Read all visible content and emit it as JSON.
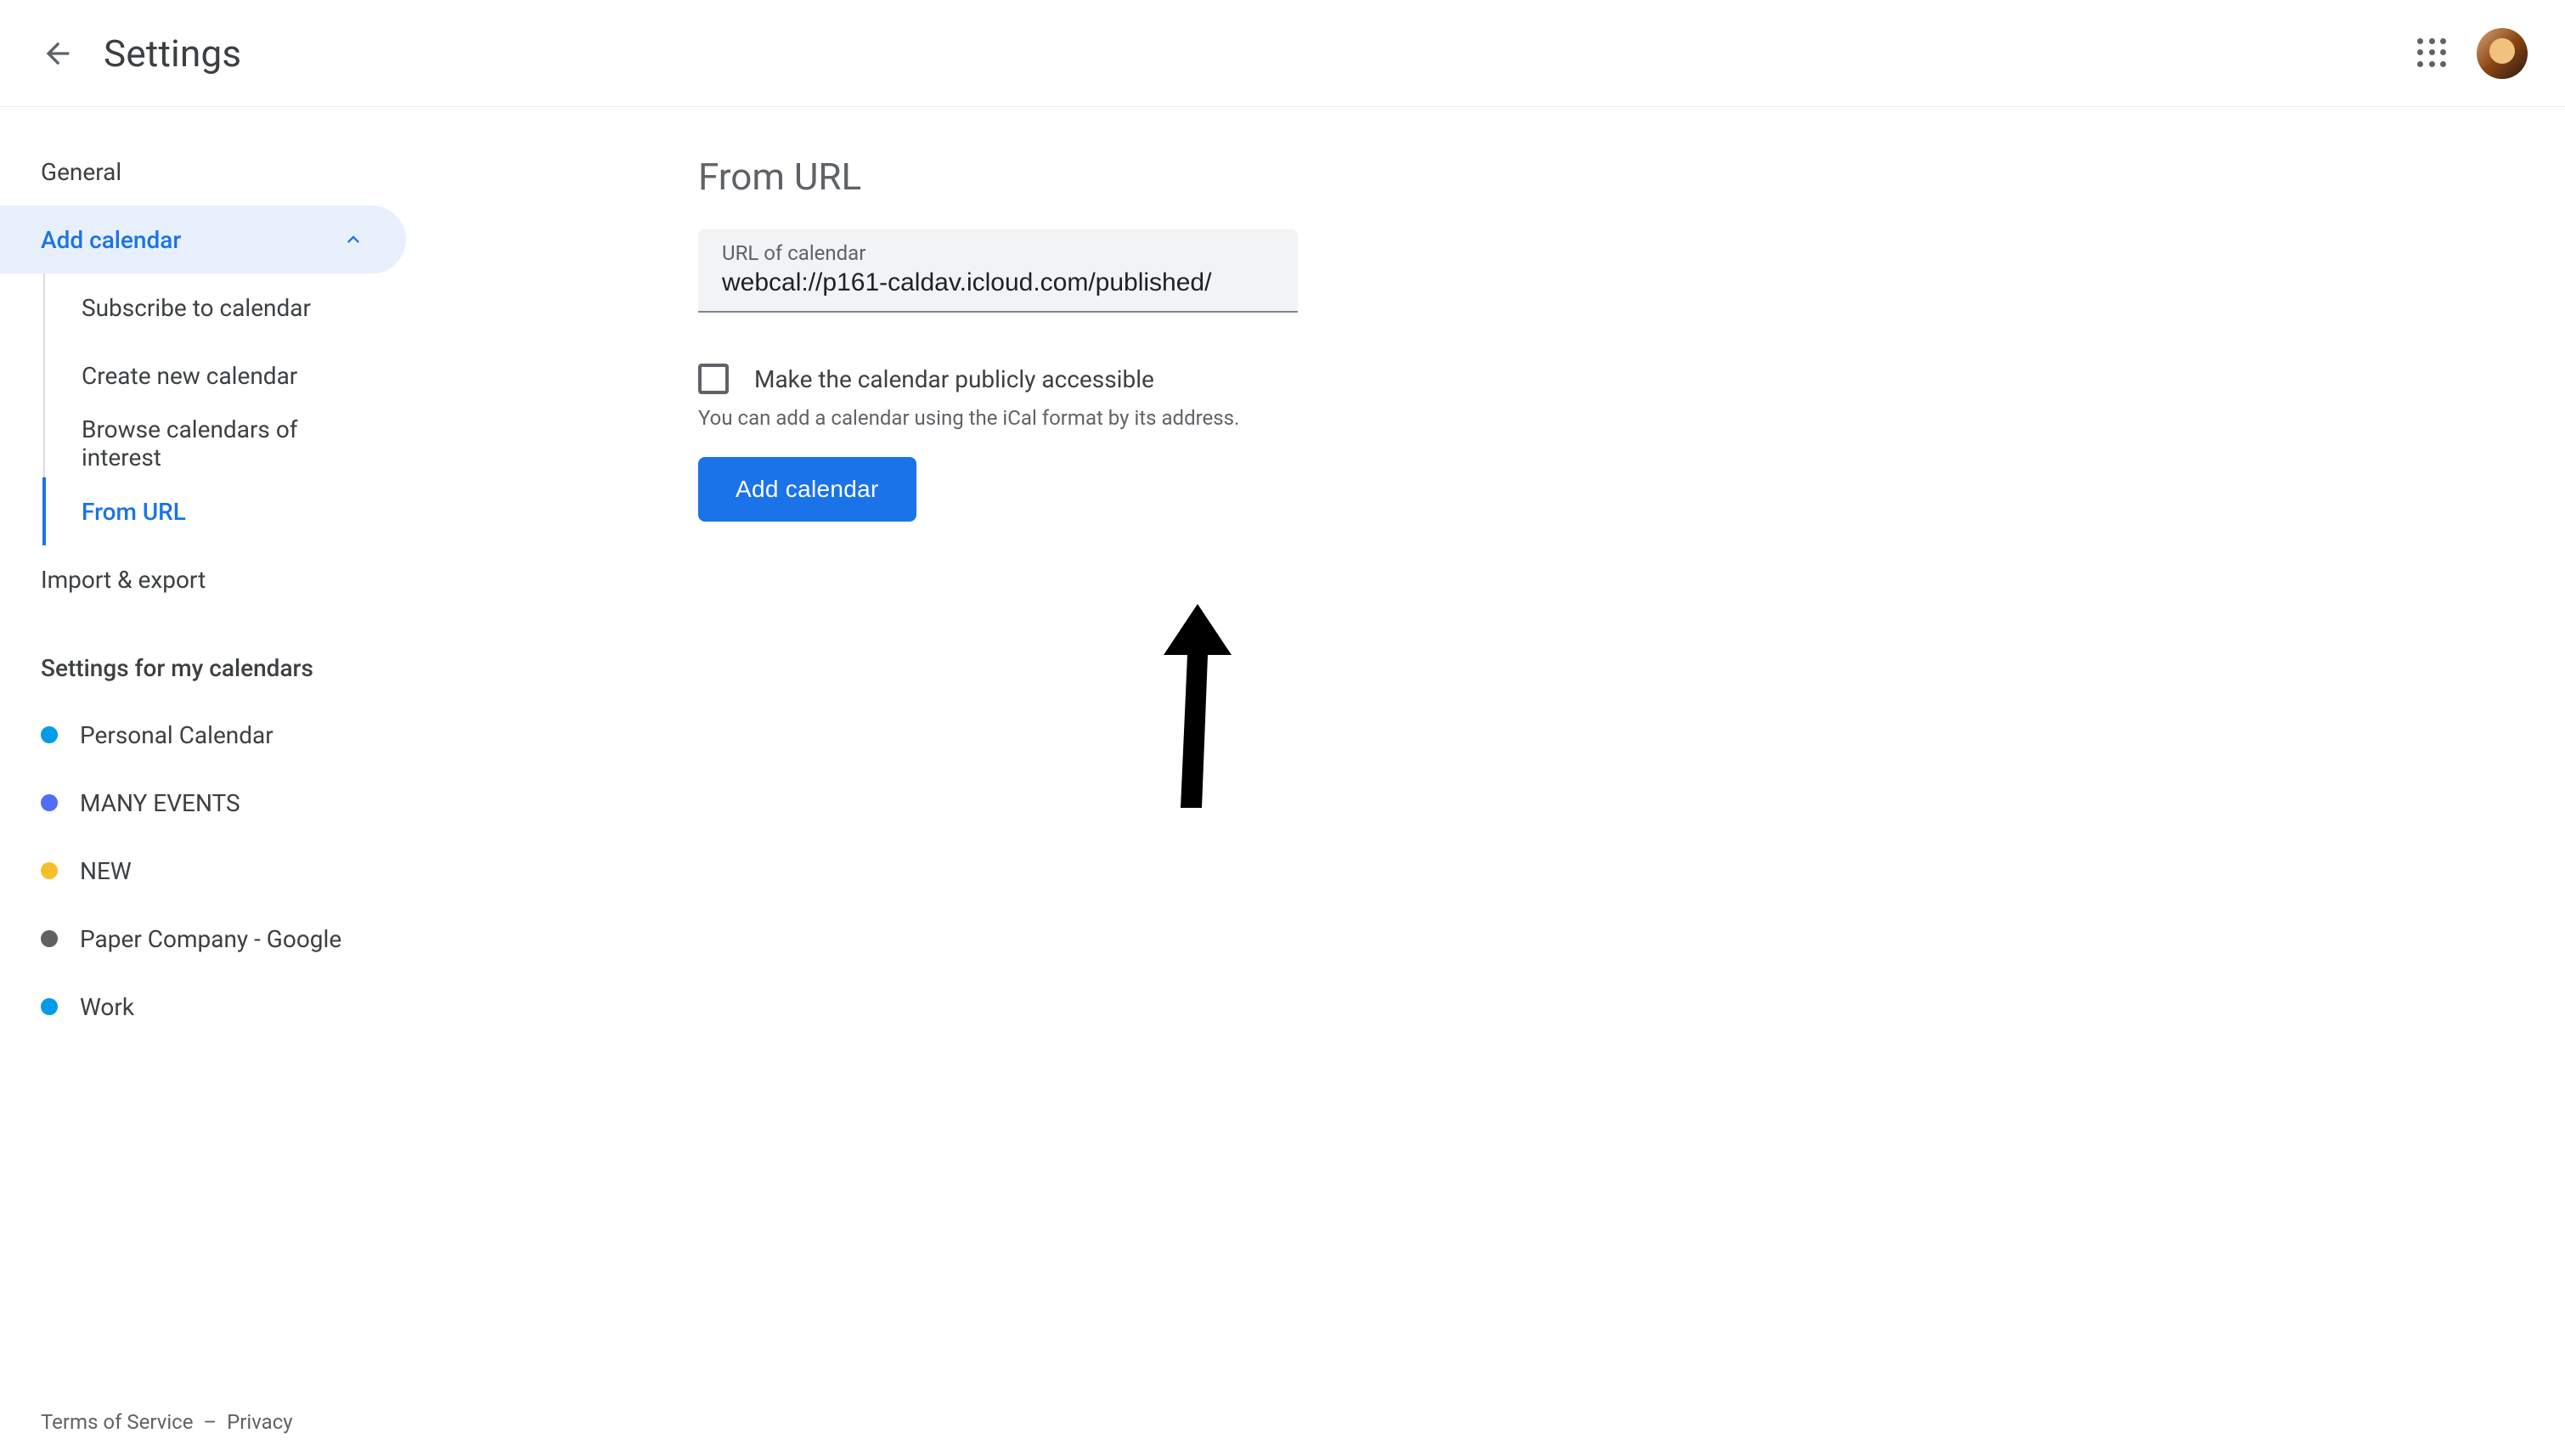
{
  "header": {
    "title": "Settings"
  },
  "sidebar": {
    "general": "General",
    "add_calendar": "Add calendar",
    "sub_items": [
      "Subscribe to calendar",
      "Create new calendar",
      "Browse calendars of interest",
      "From URL"
    ],
    "import_export": "Import & export",
    "section_header": "Settings for my calendars",
    "calendars": [
      {
        "name": "Personal Calendar",
        "color": "#039be5"
      },
      {
        "name": "MANY EVENTS",
        "color": "#4f6cf7"
      },
      {
        "name": "NEW",
        "color": "#f6bf26"
      },
      {
        "name": "Paper Company - Google",
        "color": "#616161"
      },
      {
        "name": "Work",
        "color": "#039be5"
      }
    ]
  },
  "main": {
    "title": "From URL",
    "input_label": "URL of calendar",
    "input_value": "webcal://p161-caldav.icloud.com/published/",
    "checkbox_label": "Make the calendar publicly accessible",
    "helper_text": "You can add a calendar using the iCal format by its address.",
    "button_label": "Add calendar"
  },
  "footer": {
    "terms": "Terms of Service",
    "sep": "–",
    "privacy": "Privacy"
  }
}
